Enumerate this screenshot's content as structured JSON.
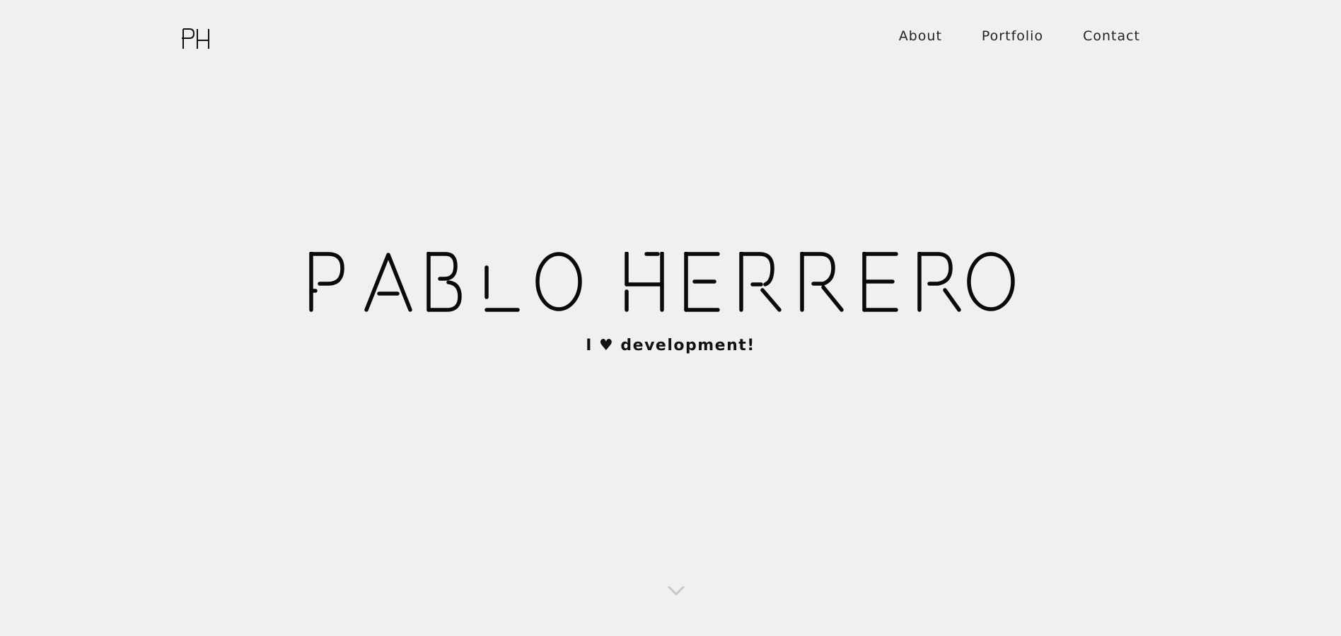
{
  "logo": {
    "text": "PH"
  },
  "nav": {
    "items": [
      {
        "label": "About"
      },
      {
        "label": "Portfolio"
      },
      {
        "label": "Contact"
      }
    ]
  },
  "hero": {
    "title": "PABLO HERRERO",
    "tagline": "I ♥ development!"
  },
  "icons": {
    "scroll": "chevron-down-icon"
  },
  "colors": {
    "background": "#f0f0f0",
    "text": "#111111",
    "chevron": "#c8c8c8"
  }
}
